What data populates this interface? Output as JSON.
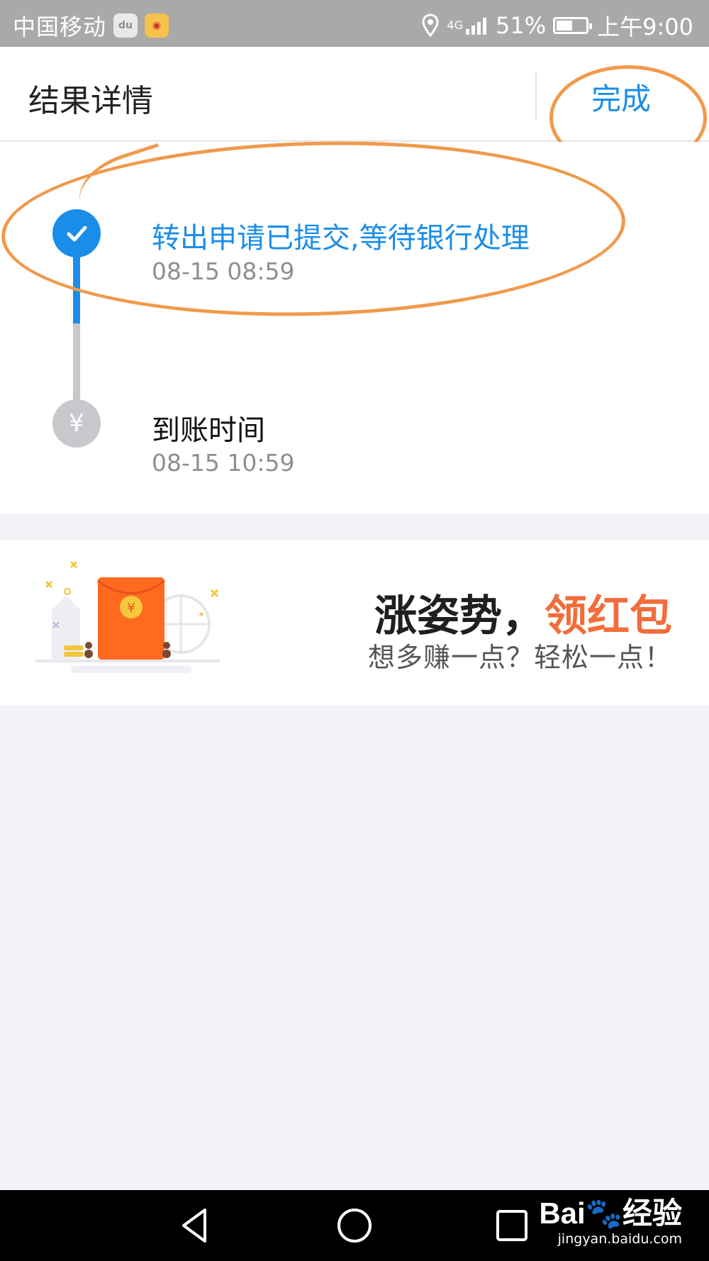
{
  "status_bar": {
    "carrier": "中国移动",
    "network": "4G",
    "battery": "51%",
    "time": "上午9:00",
    "icons": [
      "du-app-icon",
      "weibo-icon",
      "location-icon",
      "signal-icon",
      "battery-icon"
    ]
  },
  "header": {
    "title": "结果详情",
    "done_label": "完成"
  },
  "timeline": {
    "steps": [
      {
        "title": "转出申请已提交,等待银行处理",
        "time": "08-15 08:59",
        "status": "done",
        "icon": "check-icon"
      },
      {
        "title": "到账时间",
        "time": "08-15 10:59",
        "status": "pending",
        "icon": "yen-icon",
        "icon_glyph": "¥"
      }
    ]
  },
  "promo": {
    "headline": "涨姿势，",
    "headline_highlight": "领红包",
    "subtext": "想多赚一点？轻松一点！",
    "red_packet_symbol": "¥"
  },
  "nav": {
    "buttons": [
      "back-icon",
      "home-icon",
      "recent-apps-icon"
    ]
  },
  "watermark": {
    "logo": "Bai🐾经验",
    "url": "jingyan.baidu.com"
  },
  "colors": {
    "accent": "#1a8de8",
    "annotation": "#f09a4c",
    "promo_highlight": "#f16d3b",
    "pending": "#c8c8cc"
  }
}
